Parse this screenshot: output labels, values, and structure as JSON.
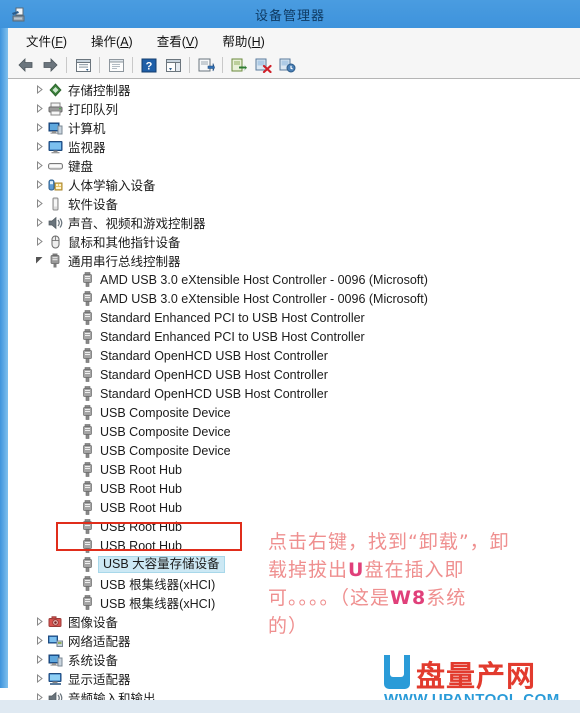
{
  "window": {
    "title": "设备管理器",
    "icon": "device-manager-icon",
    "accent_color": "#3e93dc",
    "title_color": "#0e3a63"
  },
  "menubar": {
    "items": [
      {
        "name": "file",
        "label": "文件(F)",
        "text": "文件",
        "accel": "F"
      },
      {
        "name": "action",
        "label": "操作(A)",
        "text": "操作",
        "accel": "A"
      },
      {
        "name": "view",
        "label": "查看(V)",
        "text": "查看",
        "accel": "V"
      },
      {
        "name": "help",
        "label": "帮助(H)",
        "text": "帮助",
        "accel": "H"
      }
    ]
  },
  "toolbar": {
    "buttons": [
      {
        "name": "back-icon",
        "glyph": "←"
      },
      {
        "name": "forward-icon",
        "glyph": "→"
      },
      {
        "name": "separator-1",
        "glyph": ""
      },
      {
        "name": "show-hide-console-tree-icon",
        "glyph": ""
      },
      {
        "name": "separator-2",
        "glyph": ""
      },
      {
        "name": "properties-icon",
        "glyph": ""
      },
      {
        "name": "separator-3",
        "glyph": ""
      },
      {
        "name": "help-icon",
        "glyph": "?"
      },
      {
        "name": "show-hide-action-pane-icon",
        "glyph": ""
      },
      {
        "name": "separator-4",
        "glyph": ""
      },
      {
        "name": "update-driver-icon",
        "glyph": ""
      },
      {
        "name": "separator-5",
        "glyph": ""
      },
      {
        "name": "scan-hardware-changes-icon",
        "glyph": ""
      },
      {
        "name": "uninstall-device-icon",
        "glyph": ""
      },
      {
        "name": "disable-device-icon",
        "glyph": ""
      }
    ]
  },
  "tree": {
    "nodes": [
      {
        "label": "存储控制器",
        "level": 1,
        "expanded": false,
        "icon": "storage-controller-icon",
        "selected": false
      },
      {
        "label": "打印队列",
        "level": 1,
        "expanded": false,
        "icon": "printer-icon",
        "selected": false
      },
      {
        "label": "计算机",
        "level": 1,
        "expanded": false,
        "icon": "computer-icon",
        "selected": false
      },
      {
        "label": "监视器",
        "level": 1,
        "expanded": false,
        "icon": "monitor-icon",
        "selected": false
      },
      {
        "label": "键盘",
        "level": 1,
        "expanded": false,
        "icon": "keyboard-icon",
        "selected": false
      },
      {
        "label": "人体学输入设备",
        "level": 1,
        "expanded": false,
        "icon": "hid-icon",
        "selected": false
      },
      {
        "label": "软件设备",
        "level": 1,
        "expanded": false,
        "icon": "software-device-icon",
        "selected": false
      },
      {
        "label": "声音、视频和游戏控制器",
        "level": 1,
        "expanded": false,
        "icon": "sound-icon",
        "selected": false
      },
      {
        "label": "鼠标和其他指针设备",
        "level": 1,
        "expanded": false,
        "icon": "mouse-icon",
        "selected": false
      },
      {
        "label": "通用串行总线控制器",
        "level": 1,
        "expanded": true,
        "icon": "usb-controller-icon",
        "selected": false
      },
      {
        "label": "AMD USB 3.0 eXtensible Host Controller - 0096 (Microsoft)",
        "level": 2,
        "expanded": null,
        "icon": "usb-device-icon",
        "selected": false
      },
      {
        "label": "AMD USB 3.0 eXtensible Host Controller - 0096 (Microsoft)",
        "level": 2,
        "expanded": null,
        "icon": "usb-device-icon",
        "selected": false
      },
      {
        "label": "Standard Enhanced PCI to USB Host Controller",
        "level": 2,
        "expanded": null,
        "icon": "usb-device-icon",
        "selected": false
      },
      {
        "label": "Standard Enhanced PCI to USB Host Controller",
        "level": 2,
        "expanded": null,
        "icon": "usb-device-icon",
        "selected": false
      },
      {
        "label": "Standard OpenHCD USB Host Controller",
        "level": 2,
        "expanded": null,
        "icon": "usb-device-icon",
        "selected": false
      },
      {
        "label": "Standard OpenHCD USB Host Controller",
        "level": 2,
        "expanded": null,
        "icon": "usb-device-icon",
        "selected": false
      },
      {
        "label": "Standard OpenHCD USB Host Controller",
        "level": 2,
        "expanded": null,
        "icon": "usb-device-icon",
        "selected": false
      },
      {
        "label": "USB Composite Device",
        "level": 2,
        "expanded": null,
        "icon": "usb-device-icon",
        "selected": false
      },
      {
        "label": "USB Composite Device",
        "level": 2,
        "expanded": null,
        "icon": "usb-device-icon",
        "selected": false
      },
      {
        "label": "USB Composite Device",
        "level": 2,
        "expanded": null,
        "icon": "usb-device-icon",
        "selected": false
      },
      {
        "label": "USB Root Hub",
        "level": 2,
        "expanded": null,
        "icon": "usb-device-icon",
        "selected": false
      },
      {
        "label": "USB Root Hub",
        "level": 2,
        "expanded": null,
        "icon": "usb-device-icon",
        "selected": false
      },
      {
        "label": "USB Root Hub",
        "level": 2,
        "expanded": null,
        "icon": "usb-device-icon",
        "selected": false
      },
      {
        "label": "USB Root Hub",
        "level": 2,
        "expanded": null,
        "icon": "usb-device-icon",
        "selected": false
      },
      {
        "label": "USB Root Hub",
        "level": 2,
        "expanded": null,
        "icon": "usb-device-icon",
        "selected": false
      },
      {
        "label": "USB 大容量存储设备",
        "level": 2,
        "expanded": null,
        "icon": "usb-device-icon",
        "selected": true
      },
      {
        "label": "USB 根集线器(xHCI)",
        "level": 2,
        "expanded": null,
        "icon": "usb-device-icon",
        "selected": false
      },
      {
        "label": "USB 根集线器(xHCI)",
        "level": 2,
        "expanded": null,
        "icon": "usb-device-icon",
        "selected": false
      },
      {
        "label": "图像设备",
        "level": 1,
        "expanded": false,
        "icon": "imaging-device-icon",
        "selected": false
      },
      {
        "label": "网络适配器",
        "level": 1,
        "expanded": false,
        "icon": "network-adapter-icon",
        "selected": false
      },
      {
        "label": "系统设备",
        "level": 1,
        "expanded": false,
        "icon": "system-device-icon",
        "selected": false
      },
      {
        "label": "显示适配器",
        "level": 1,
        "expanded": false,
        "icon": "display-adapter-icon",
        "selected": false
      },
      {
        "label": "音频输入和输出",
        "level": 1,
        "expanded": false,
        "icon": "audio-io-icon",
        "selected": false
      }
    ]
  },
  "annotation": {
    "color": "#ef8f8f",
    "highlight_color": "#e0407a",
    "line1": "点击右键，找到“卸载”，卸",
    "line2_a": "载掉拔出",
    "line2_b": "U",
    "line2_c": "盘在插入即",
    "line3_a": "可。。。。（这是",
    "line3_b": "W8",
    "line3_c": "系统",
    "line4": "的）",
    "box_color": "#e02d1b"
  },
  "watermark": {
    "logo_letter": "U",
    "brand": "盘量产网",
    "url": "WWW.UPANTOOL.COM",
    "brand_color": "#e23b2e",
    "url_color": "#2a9bd8"
  }
}
